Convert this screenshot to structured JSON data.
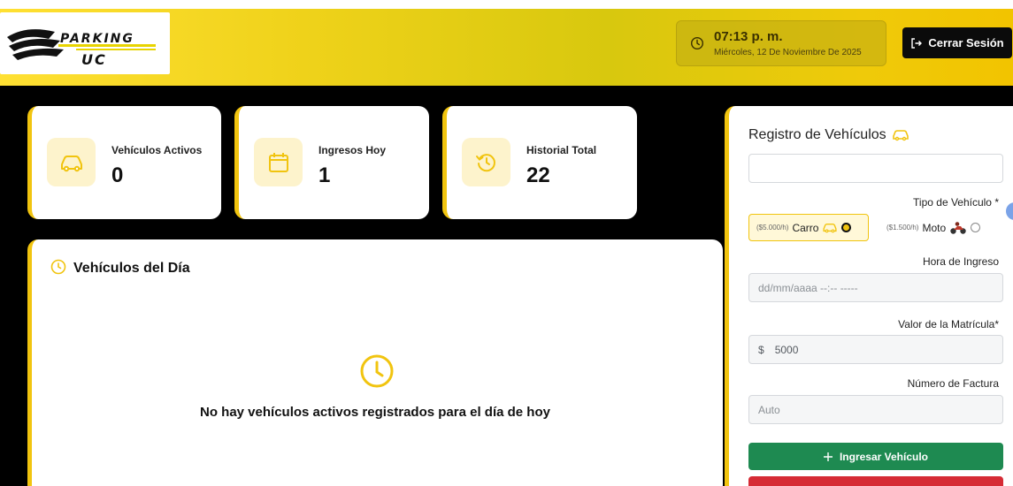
{
  "header": {
    "logo_line1": "PARKING",
    "logo_line2": "UC",
    "time": "07:13 p. m.",
    "date": "Miércoles, 12 De Noviembre De 2025",
    "logout_label": "Cerrar Sesión",
    "colors": {
      "accent": "#f1c40f",
      "logout_bg": "#0b0b0b"
    }
  },
  "stats": [
    {
      "label": "Vehículos Activos",
      "value": "0",
      "icon": "car-icon"
    },
    {
      "label": "Ingresos Hoy",
      "value": "1",
      "icon": "calendar-icon"
    },
    {
      "label": "Historial Total",
      "value": "22",
      "icon": "history-icon"
    }
  ],
  "day_panel": {
    "title": "Vehículos del Día",
    "empty_message": "No hay vehículos activos registrados para el día de hoy"
  },
  "registration": {
    "title": "Registro de Vehículos",
    "plate_value": "",
    "vehicle_type_label": "Tipo de Vehículo *",
    "types": [
      {
        "price": "($5.000/h)",
        "name": "Carro",
        "selected": true
      },
      {
        "price": "($1.500/h)",
        "name": "Moto",
        "selected": false
      }
    ],
    "entry_time_label": "Hora de Ingreso",
    "entry_time_placeholder": "dd/mm/aaaa --:-- -----",
    "fee_label": "Valor de la Matrícula*",
    "fee_currency": "$",
    "fee_value": "5000",
    "invoice_label": "Número de Factura",
    "invoice_placeholder": "Auto",
    "submit_label": "Ingresar Vehículo",
    "colors": {
      "submit": "#1e8a51",
      "danger": "#d62b35"
    }
  }
}
